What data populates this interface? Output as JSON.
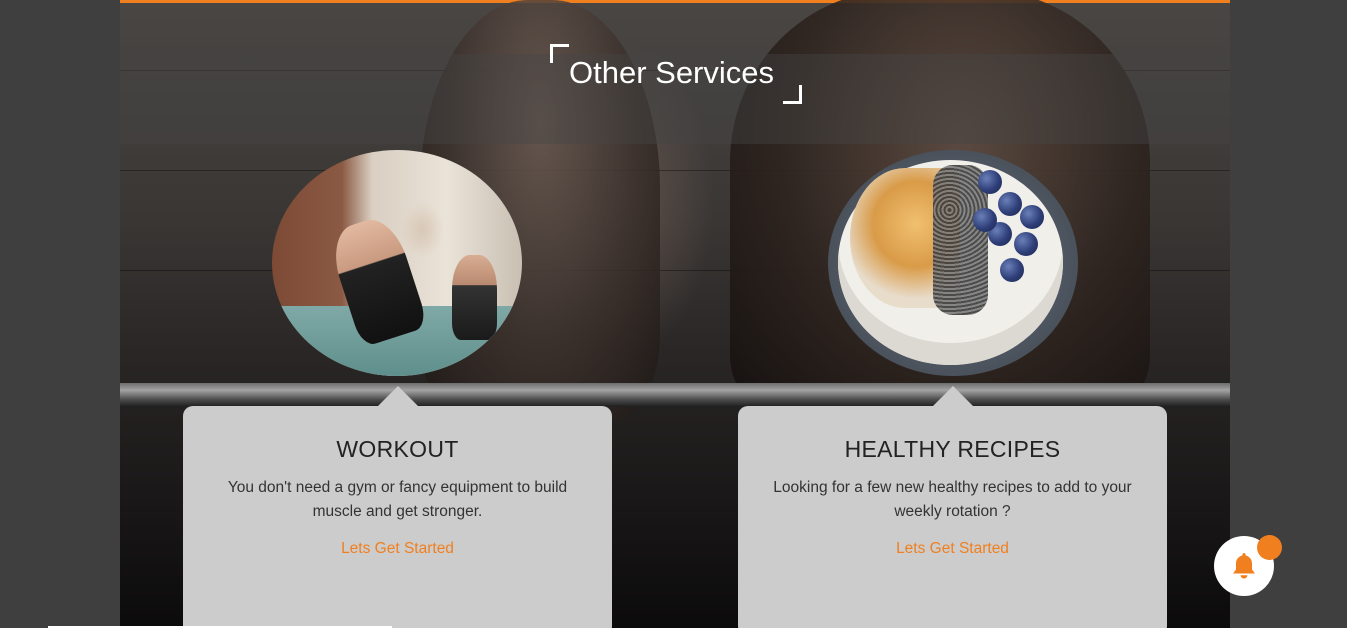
{
  "section": {
    "title": "Other Services"
  },
  "services": [
    {
      "title": "WORKOUT",
      "description": "You don't need a gym or fancy equipment to build muscle and get stronger.",
      "link": "Lets Get Started",
      "image_icon": "yoga-class-photo"
    },
    {
      "title": "HEALTHY RECIPES",
      "description": "Looking for a few new healthy recipes to add to your weekly rotation ?",
      "link": "Lets Get Started",
      "image_icon": "oatmeal-bowl-photo"
    }
  ],
  "notification": {
    "icon": "bell-icon"
  },
  "colors": {
    "accent": "#f07f1f",
    "card_background": "#cccccc",
    "page_background": "#3f3f3f"
  }
}
